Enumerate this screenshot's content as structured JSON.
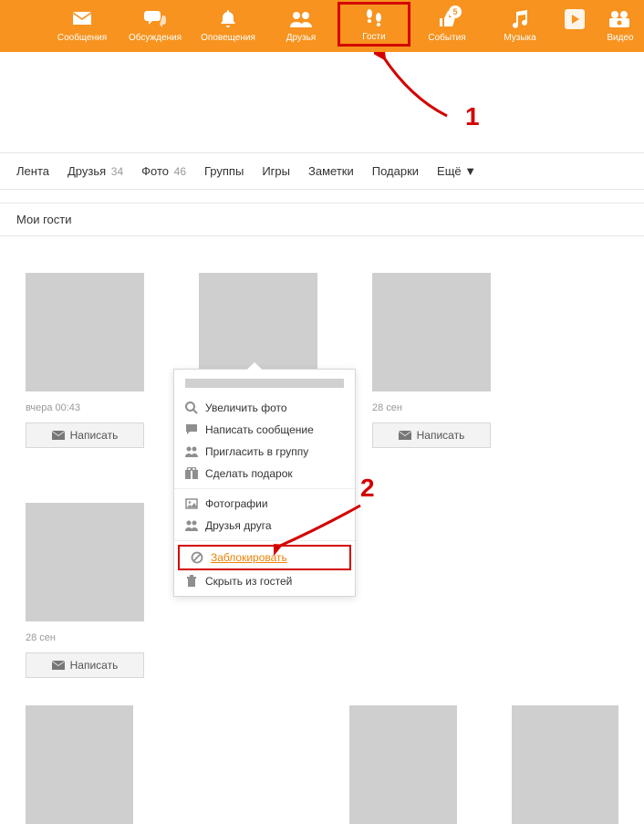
{
  "topnav": [
    {
      "id": "messages",
      "label": "Сообщения",
      "icon": "mail"
    },
    {
      "id": "discussions",
      "label": "Обсуждения",
      "icon": "chat"
    },
    {
      "id": "notifications",
      "label": "Оповещения",
      "icon": "bell"
    },
    {
      "id": "friends",
      "label": "Друзья",
      "icon": "people"
    },
    {
      "id": "guests",
      "label": "Гости",
      "icon": "footprints",
      "highlighted": true
    },
    {
      "id": "events",
      "label": "События",
      "icon": "thumbs-up",
      "badge": "5"
    },
    {
      "id": "music",
      "label": "Музыка",
      "icon": "music"
    },
    {
      "id": "play",
      "label": "",
      "icon": "play"
    },
    {
      "id": "video",
      "label": "Видео",
      "icon": "video"
    }
  ],
  "subnav": {
    "feed": "Лента",
    "friends": "Друзья",
    "friends_count": "34",
    "photos": "Фото",
    "photos_count": "46",
    "groups": "Группы",
    "games": "Игры",
    "notes": "Заметки",
    "gifts": "Подарки",
    "more": "Ещё ▼"
  },
  "section_title": "Мои гости",
  "write_label": "Написать",
  "guests": [
    {
      "timestamp": "вчера 00:43"
    },
    {
      "timestamp": ""
    },
    {
      "timestamp": "28 сен"
    },
    {
      "timestamp": "28 сен"
    }
  ],
  "context_menu": {
    "enlarge": "Увеличить фото",
    "message": "Написать сообщение",
    "invite": "Пригласить в группу",
    "gift": "Сделать подарок",
    "photos": "Фотографии",
    "mutual": "Друзья друга",
    "block": "Заблокировать",
    "hide": "Скрыть из гостей"
  },
  "annotations": {
    "num1": "1",
    "num2": "2"
  }
}
